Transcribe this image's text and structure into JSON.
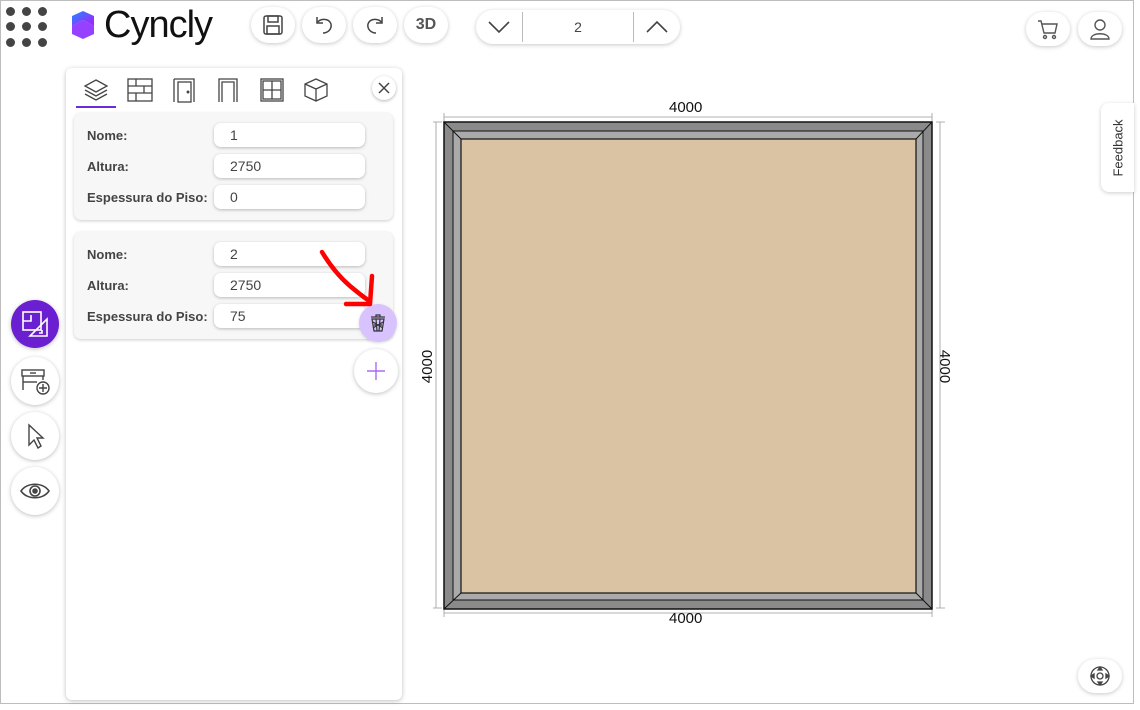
{
  "app": {
    "name": "Cyncly"
  },
  "toolbar": {
    "view_3d_label": "3D",
    "current_level": "2"
  },
  "panel": {
    "tabs": [
      "layers",
      "walls",
      "doors",
      "openings",
      "windows",
      "objects"
    ],
    "levels": [
      {
        "name_label": "Nome:",
        "name_value": "1",
        "height_label": "Altura:",
        "height_value": "2750",
        "thickness_label": "Espessura do Piso:",
        "thickness_value": "0"
      },
      {
        "name_label": "Nome:",
        "name_value": "2",
        "height_label": "Altura:",
        "height_value": "2750",
        "thickness_label": "Espessura do Piso:",
        "thickness_value": "75"
      }
    ]
  },
  "canvas": {
    "dims": {
      "top": "4000",
      "bottom": "4000",
      "left": "4000",
      "right": "4000"
    },
    "floor_color": "#d9c3a3",
    "wall_color": "#8a8a8a"
  },
  "feedback_label": "Feedback",
  "colors": {
    "accent": "#6a1fd1",
    "accent_light": "#d9c3ff",
    "annotation": "#ff0000"
  },
  "icons": {
    "menu": "grid-dots-icon",
    "save": "save-icon",
    "undo": "undo-icon",
    "redo": "redo-icon",
    "level_down": "chevron-down-icon",
    "level_up": "chevron-up-icon",
    "cart": "cart-icon",
    "user": "user-icon",
    "close": "close-icon",
    "trash": "trash-icon",
    "add": "plus-icon",
    "recenter": "recenter-icon"
  }
}
